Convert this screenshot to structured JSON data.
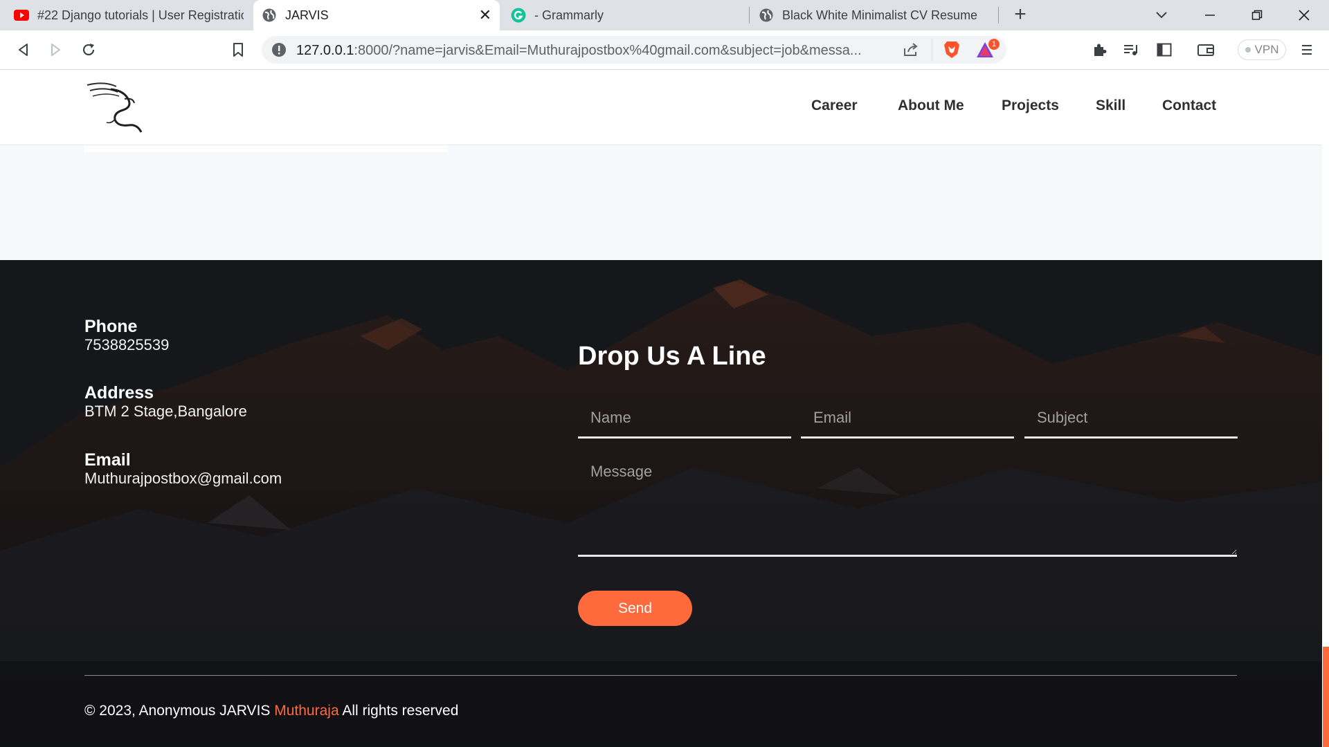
{
  "browser": {
    "tabs": [
      {
        "title": "#22 Django tutorials | User Registratio",
        "icon": "youtube-icon"
      },
      {
        "title": "JARVIS",
        "icon": "globe-icon",
        "active": true
      },
      {
        "title": "- Grammarly",
        "icon": "grammarly-icon"
      },
      {
        "title": "Black White Minimalist CV Resume",
        "icon": "globe-icon"
      }
    ],
    "url": "127.0.0.1:8000/?name=jarvis&Email=Muthurajpostbox%40gmail.com&subject=job&messa...",
    "url_host": "127.0.0.1",
    "url_rest": ":8000/?name=jarvis&Email=Muthurajpostbox%40gmail.com&subject=job&messa...",
    "brave_badge": "1",
    "vpn_label": "VPN"
  },
  "nav": {
    "items": [
      "Career",
      "About Me",
      "Projects",
      "Skill",
      "Contact"
    ]
  },
  "contact_info": {
    "phone_label": "Phone",
    "phone": "7538825539",
    "address_label": "Address",
    "address": "BTM 2 Stage,Bangalore",
    "email_label": "Email",
    "email": "Muthurajpostbox@gmail.com"
  },
  "form": {
    "title": "Drop Us A Line",
    "name_placeholder": "Name",
    "email_placeholder": "Email",
    "subject_placeholder": "Subject",
    "message_placeholder": "Message",
    "send_label": "Send"
  },
  "footer": {
    "copyright_prefix": "© 2023, Anonymous JARVIS ",
    "copyright_name": "Muthuraja",
    "copyright_suffix": " All rights reserved"
  },
  "colors": {
    "accent": "#ff6a3d",
    "footer_bg": "#14161a",
    "light_section": "#f6f8fc"
  }
}
